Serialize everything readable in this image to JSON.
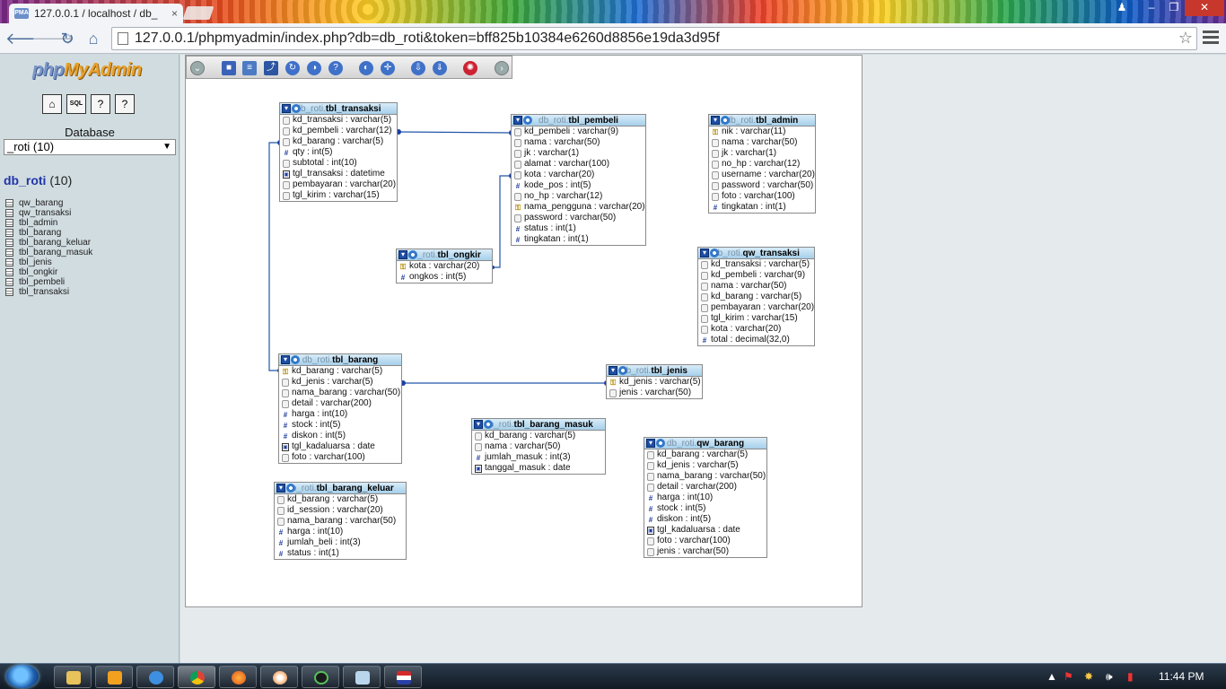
{
  "browser": {
    "tab_title": "127.0.0.1 / localhost / db_",
    "tab_favicon": "PMA",
    "url": "127.0.0.1/phpmyadmin/index.php?db=db_roti&token=bff825b10384e6260d8856e19da3d95f"
  },
  "sidebar": {
    "logo_php": "php",
    "logo_myadmin": "MyAdmin",
    "database_label": "Database",
    "database_select": "_roti (10)",
    "db_name": "db_roti",
    "db_count": "(10)",
    "tables": [
      "qw_barang",
      "qw_transaksi",
      "tbl_admin",
      "tbl_barang",
      "tbl_barang_keluar",
      "tbl_barang_masuk",
      "tbl_jenis",
      "tbl_ongkir",
      "tbl_pembeli",
      "tbl_transaksi"
    ]
  },
  "designer": {
    "db_prefix": "db_roti.",
    "tables": [
      {
        "name": "tbl_transaksi",
        "cols": [
          {
            "t": "str",
            "c": "kd_transaksi : varchar(5)"
          },
          {
            "t": "str",
            "c": "kd_pembeli : varchar(12)"
          },
          {
            "t": "str",
            "c": "kd_barang : varchar(5)"
          },
          {
            "t": "num",
            "c": "qty : int(5)"
          },
          {
            "t": "str",
            "c": "subtotal : int(10)"
          },
          {
            "t": "date",
            "c": "tgl_transaksi : datetime"
          },
          {
            "t": "str",
            "c": "pembayaran : varchar(20)"
          },
          {
            "t": "str",
            "c": "tgl_kirim : varchar(15)"
          }
        ]
      },
      {
        "name": "tbl_pembeli",
        "cols": [
          {
            "t": "str",
            "c": "kd_pembeli : varchar(9)"
          },
          {
            "t": "str",
            "c": "nama : varchar(50)"
          },
          {
            "t": "str",
            "c": "jk : varchar(1)"
          },
          {
            "t": "str",
            "c": "alamat : varchar(100)"
          },
          {
            "t": "str",
            "c": "kota : varchar(20)"
          },
          {
            "t": "num",
            "c": "kode_pos : int(5)"
          },
          {
            "t": "str",
            "c": "no_hp : varchar(12)"
          },
          {
            "t": "key",
            "c": "nama_pengguna : varchar(20)"
          },
          {
            "t": "str",
            "c": "password : varchar(50)"
          },
          {
            "t": "num",
            "c": "status : int(1)"
          },
          {
            "t": "num",
            "c": "tingkatan : int(1)"
          }
        ]
      },
      {
        "name": "tbl_admin",
        "cols": [
          {
            "t": "key",
            "c": "nik : varchar(11)"
          },
          {
            "t": "str",
            "c": "nama : varchar(50)"
          },
          {
            "t": "str",
            "c": "jk : varchar(1)"
          },
          {
            "t": "str",
            "c": "no_hp : varchar(12)"
          },
          {
            "t": "str",
            "c": "username : varchar(20)"
          },
          {
            "t": "str",
            "c": "password : varchar(50)"
          },
          {
            "t": "str",
            "c": "foto : varchar(100)"
          },
          {
            "t": "num",
            "c": "tingkatan : int(1)"
          }
        ]
      },
      {
        "name": "tbl_ongkir",
        "cols": [
          {
            "t": "key",
            "c": "kota : varchar(20)"
          },
          {
            "t": "num",
            "c": "ongkos : int(5)"
          }
        ]
      },
      {
        "name": "qw_transaksi",
        "cols": [
          {
            "t": "str",
            "c": "kd_transaksi : varchar(5)"
          },
          {
            "t": "str",
            "c": "kd_pembeli : varchar(9)"
          },
          {
            "t": "str",
            "c": "nama : varchar(50)"
          },
          {
            "t": "str",
            "c": "kd_barang : varchar(5)"
          },
          {
            "t": "str",
            "c": "pembayaran : varchar(20)"
          },
          {
            "t": "str",
            "c": "tgl_kirim : varchar(15)"
          },
          {
            "t": "str",
            "c": "kota : varchar(20)"
          },
          {
            "t": "num",
            "c": "total : decimal(32,0)"
          }
        ]
      },
      {
        "name": "tbl_barang",
        "cols": [
          {
            "t": "key",
            "c": "kd_barang : varchar(5)"
          },
          {
            "t": "str",
            "c": "kd_jenis : varchar(5)"
          },
          {
            "t": "str",
            "c": "nama_barang : varchar(50)"
          },
          {
            "t": "str",
            "c": "detail : varchar(200)"
          },
          {
            "t": "num",
            "c": "harga : int(10)"
          },
          {
            "t": "num",
            "c": "stock : int(5)"
          },
          {
            "t": "num",
            "c": "diskon : int(5)"
          },
          {
            "t": "date",
            "c": "tgl_kadaluarsa : date"
          },
          {
            "t": "str",
            "c": "foto : varchar(100)"
          }
        ]
      },
      {
        "name": "tbl_jenis",
        "cols": [
          {
            "t": "key",
            "c": "kd_jenis : varchar(5)"
          },
          {
            "t": "str",
            "c": "jenis : varchar(50)"
          }
        ]
      },
      {
        "name": "tbl_barang_masuk",
        "cols": [
          {
            "t": "str",
            "c": "kd_barang : varchar(5)"
          },
          {
            "t": "str",
            "c": "nama : varchar(50)"
          },
          {
            "t": "num",
            "c": "jumlah_masuk : int(3)"
          },
          {
            "t": "date",
            "c": "tanggal_masuk : date"
          }
        ]
      },
      {
        "name": "qw_barang",
        "cols": [
          {
            "t": "str",
            "c": "kd_barang : varchar(5)"
          },
          {
            "t": "str",
            "c": "kd_jenis : varchar(5)"
          },
          {
            "t": "str",
            "c": "nama_barang : varchar(50)"
          },
          {
            "t": "str",
            "c": "detail : varchar(200)"
          },
          {
            "t": "num",
            "c": "harga : int(10)"
          },
          {
            "t": "num",
            "c": "stock : int(5)"
          },
          {
            "t": "num",
            "c": "diskon : int(5)"
          },
          {
            "t": "date",
            "c": "tgl_kadaluarsa : date"
          },
          {
            "t": "str",
            "c": "foto : varchar(100)"
          },
          {
            "t": "str",
            "c": "jenis : varchar(50)"
          }
        ]
      },
      {
        "name": "tbl_barang_keluar",
        "cols": [
          {
            "t": "str",
            "c": "kd_barang : varchar(5)"
          },
          {
            "t": "str",
            "c": "id_session : varchar(20)"
          },
          {
            "t": "str",
            "c": "nama_barang : varchar(50)"
          },
          {
            "t": "num",
            "c": "harga : int(10)"
          },
          {
            "t": "num",
            "c": "jumlah_beli : int(3)"
          },
          {
            "t": "num",
            "c": "status : int(1)"
          }
        ]
      }
    ]
  },
  "taskbar": {
    "clock": "11:44 PM",
    "apps": [
      "explorer",
      "media-player",
      "internet-explorer",
      "chrome",
      "firefox",
      "media-app",
      "camera-app",
      "notepad",
      "flag-app"
    ]
  },
  "colors": {
    "relation_line": "#2255a8",
    "table_header": "#a6cfea",
    "sidebar_bg": "#d0dce0"
  }
}
